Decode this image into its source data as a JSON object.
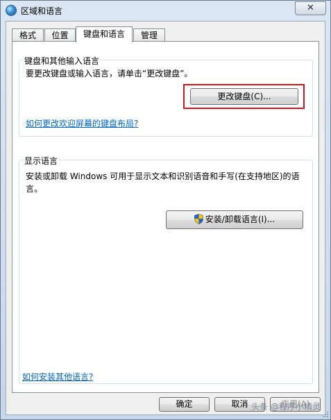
{
  "window": {
    "title": "区域和语言",
    "close_label": "✕"
  },
  "tabs": [
    {
      "label": "格式"
    },
    {
      "label": "位置"
    },
    {
      "label": "键盘和语言"
    },
    {
      "label": "管理"
    }
  ],
  "keyboard_group": {
    "title": "键盘和其他输入语言",
    "instruction": "要更改键盘或输入语言，请单击“更改键盘”。",
    "change_button": "更改键盘(C)...",
    "welcome_link": "如何更改欢迎屏幕的键盘布局?"
  },
  "display_group": {
    "title": "显示语言",
    "description": "安装或卸载 Windows 可用于显示文本和识别语音和手写(在支持地区)的语言。",
    "install_button": "安装/卸载语言(I)..."
  },
  "footer": {
    "install_link": "如何安装其他语言?",
    "ok": "确定",
    "cancel": "取消",
    "apply": "应用(A)"
  },
  "watermark": "头条 @程序小精灵",
  "colors": {
    "highlight": "#d9141a",
    "link": "#0066cc"
  }
}
